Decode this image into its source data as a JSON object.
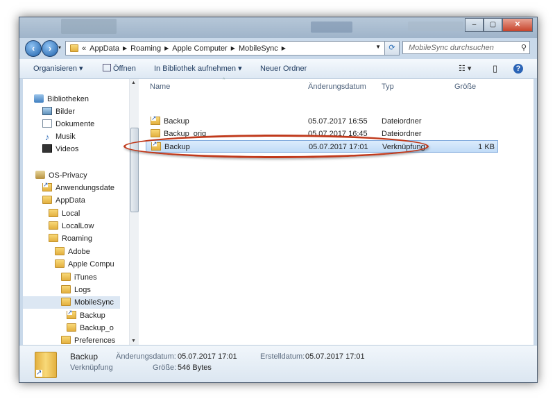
{
  "titlebar": {
    "minimize": "–",
    "maximize": "▢",
    "close": "✕"
  },
  "address": {
    "overflow": "«",
    "segments": [
      "AppData",
      "Roaming",
      "Apple Computer",
      "MobileSync"
    ],
    "search_placeholder": "MobileSync durchsuchen"
  },
  "toolbar": {
    "organize": "Organisieren ▾",
    "open": "Öffnen",
    "include_library": "In Bibliothek aufnehmen ▾",
    "new_folder": "Neuer Ordner",
    "views": "☷ ▾",
    "preview": "▯",
    "help": "?"
  },
  "nav": {
    "items": [
      {
        "label": "Bibliotheken",
        "icon": "library-icon"
      },
      {
        "label": "Bilder",
        "icon": "pictures-icon"
      },
      {
        "label": "Dokumente",
        "icon": "documents-icon"
      },
      {
        "label": "Musik",
        "icon": "music-icon"
      },
      {
        "label": "Videos",
        "icon": "videos-icon"
      },
      {
        "label": "OS-Privacy",
        "icon": "user-icon"
      },
      {
        "label": "Anwendungsdate",
        "icon": "shortcut-folder-icon"
      },
      {
        "label": "AppData",
        "icon": "folder-icon"
      },
      {
        "label": "Local",
        "icon": "folder-icon"
      },
      {
        "label": "LocalLow",
        "icon": "folder-icon"
      },
      {
        "label": "Roaming",
        "icon": "folder-icon"
      },
      {
        "label": "Adobe",
        "icon": "folder-icon"
      },
      {
        "label": "Apple Compu",
        "icon": "folder-icon"
      },
      {
        "label": "iTunes",
        "icon": "folder-icon"
      },
      {
        "label": "Logs",
        "icon": "folder-icon"
      },
      {
        "label": "MobileSync",
        "icon": "folder-icon"
      },
      {
        "label": "Backup",
        "icon": "shortcut-folder-icon"
      },
      {
        "label": "Backup_o",
        "icon": "folder-icon"
      },
      {
        "label": "Preferences",
        "icon": "folder-icon"
      }
    ]
  },
  "columns": {
    "name": "Name",
    "date": "Änderungsdatum",
    "type": "Typ",
    "size": "Größe"
  },
  "files": [
    {
      "name": "Backup",
      "date": "05.07.2017 16:55",
      "type": "Dateiordner",
      "size": ""
    },
    {
      "name": "Backup_orig",
      "date": "05.07.2017 16:45",
      "type": "Dateiordner",
      "size": ""
    },
    {
      "name": "Backup",
      "date": "05.07.2017 17:01",
      "type": "Verknüpfung",
      "size": "1 KB"
    }
  ],
  "details": {
    "name": "Backup",
    "type": "Verknüpfung",
    "modified_label": "Änderungsdatum:",
    "modified_value": "05.07.2017 17:01",
    "size_label": "Größe:",
    "size_value": "546 Bytes",
    "created_label": "Erstelldatum:",
    "created_value": "05.07.2017 17:01"
  },
  "colors": {
    "highlight_oval": "#c0391b",
    "selection": "#c1dcf7"
  }
}
